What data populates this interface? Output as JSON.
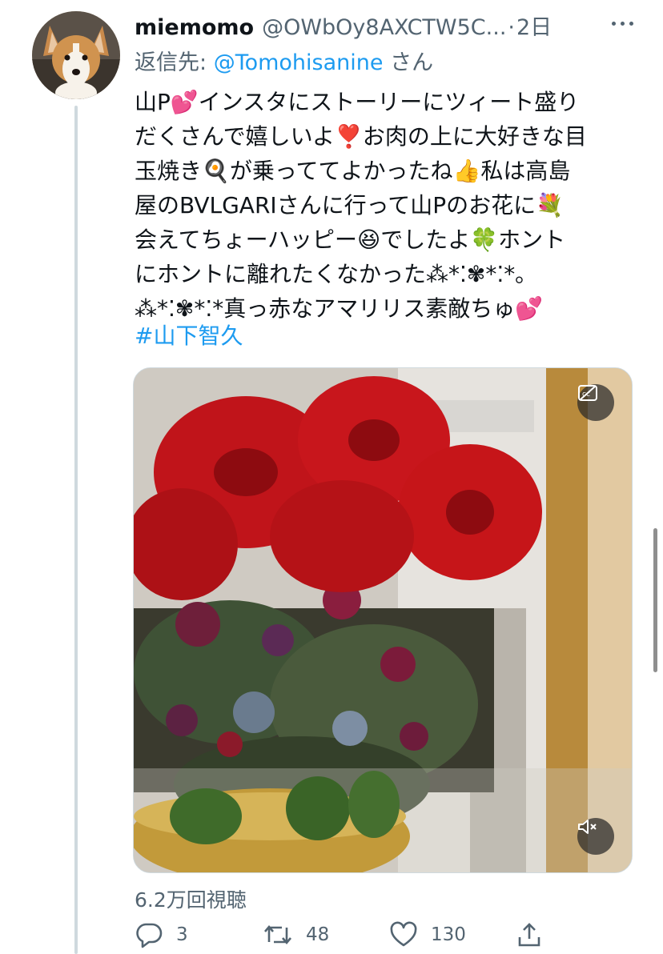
{
  "tweet": {
    "author_name": "miemomo",
    "author_handle": "@OWbOy8AXCTW5C...",
    "dot": "·",
    "time": "2日",
    "reply_prefix": "返信先: ",
    "reply_mention": "@Tomohisanine",
    "reply_suffix": " さん",
    "text_lines": [
      "山P💕インスタにストーリーにツィート盛り",
      "だくさんで嬉しいよ❣️お肉の上に大好きな目",
      "玉焼き🍳が乗っててよかったね👍私は高島",
      "屋のBVLGARIさんに行って山Pのお花に💐",
      "会えてちょーハッピー😆でしたよ🍀ホント",
      "にホントに離れたくなかった⁂*⁚✾*⁚*｡",
      "⁂*⁚✾*⁚*真っ赤なアマリリス素敵ちゅ💕"
    ],
    "hashtag": "#山下智久",
    "views": "6.2万回視聴",
    "replies": "3",
    "retweets": "48",
    "likes": "130"
  },
  "icons": {
    "more": "more-icon",
    "captions": "captions-icon",
    "mute": "volume-muted-icon",
    "reply": "reply-icon",
    "retweet": "retweet-icon",
    "like": "heart-icon",
    "share": "share-icon"
  },
  "colors": {
    "link": "#1d9bf0",
    "secondary_text": "#536471",
    "primary_text": "#0f1419",
    "thread_line": "#cfd9de"
  }
}
